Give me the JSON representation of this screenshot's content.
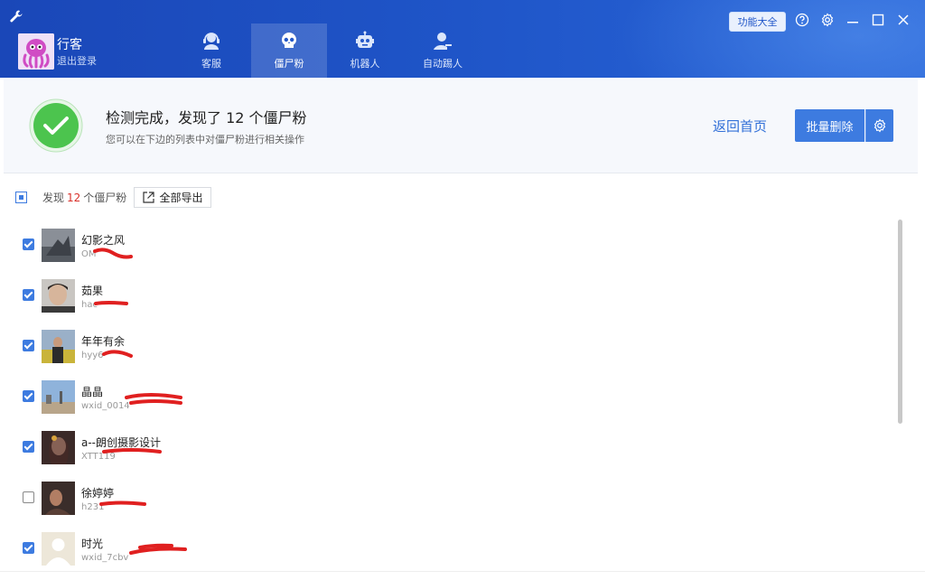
{
  "header": {
    "user_name": "行客",
    "logout_label": "退出登录",
    "tabs": [
      {
        "label": "客服",
        "icon": "headset-icon"
      },
      {
        "label": "僵尸粉",
        "icon": "skull-icon"
      },
      {
        "label": "机器人",
        "icon": "robot-icon"
      },
      {
        "label": "自动踢人",
        "icon": "kick-user-icon"
      }
    ],
    "feature_button": "功能大全"
  },
  "result": {
    "title": "检测完成，发现了 12 个僵尸粉",
    "subtitle": "您可以在下边的列表中对僵尸粉进行相关操作",
    "back_home": "返回首页",
    "batch_delete": "批量删除"
  },
  "toolbar": {
    "found_prefix": "发现",
    "found_count": "12",
    "found_suffix": "个僵尸粉",
    "export_label": "全部导出"
  },
  "list": [
    {
      "name": "幻影之风",
      "id": "OM",
      "checked": true
    },
    {
      "name": "茹果",
      "id": "hac",
      "checked": true
    },
    {
      "name": "年年有余",
      "id": "hyy6",
      "checked": true
    },
    {
      "name": "晶晶",
      "id": "wxid_0014",
      "checked": true
    },
    {
      "name": "a--朗创摄影设计",
      "id": "XTT119",
      "checked": true
    },
    {
      "name": "徐婷婷",
      "id": "h231",
      "checked": false
    },
    {
      "name": "时光",
      "id": "wxid_7cbv",
      "checked": true
    }
  ],
  "colors": {
    "header_blue": "#1f55c8",
    "primary_button": "#3d7be0",
    "success_green": "#4cc44e",
    "count_red": "#d9312b",
    "redaction_red": "#e02020"
  }
}
